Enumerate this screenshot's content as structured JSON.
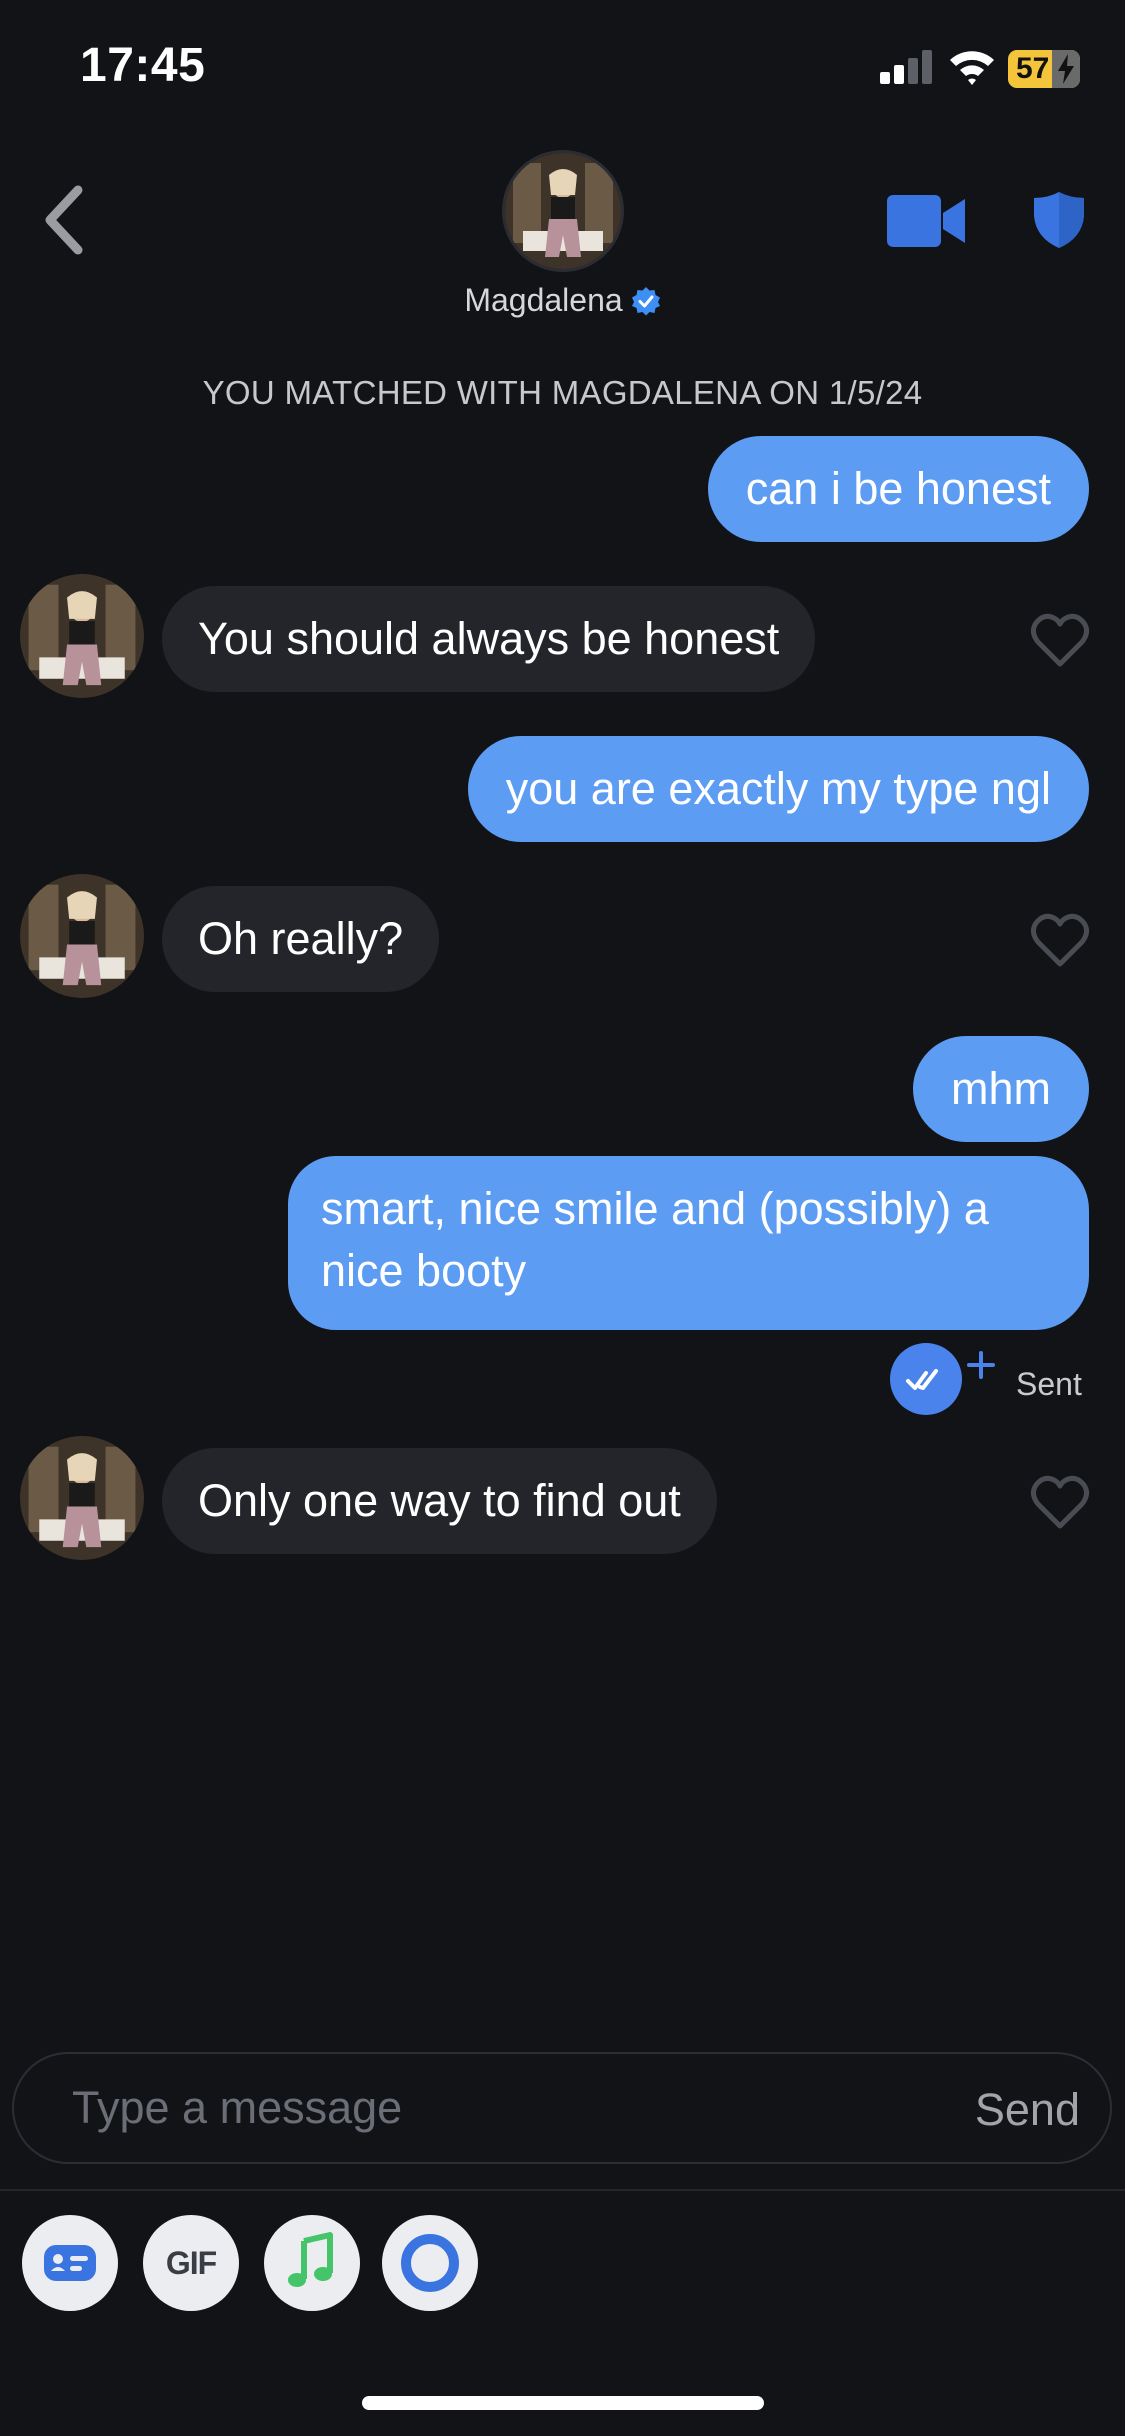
{
  "status_bar": {
    "time": "17:45",
    "battery_percent": "57",
    "icons": [
      "cellular-signal-icon",
      "wifi-icon",
      "battery-charging-icon"
    ]
  },
  "header": {
    "name": "Magdalena",
    "icons": [
      "back-chevron-icon",
      "verified-badge-icon",
      "video-call-icon",
      "safety-shield-icon"
    ]
  },
  "match_banner": "YOU MATCHED WITH MAGDALENA ON 1/5/24",
  "messages": [
    {
      "direction": "out",
      "text": "can i be honest"
    },
    {
      "direction": "in",
      "text": "You should always be honest"
    },
    {
      "direction": "out",
      "text": "you are exactly my type ngl"
    },
    {
      "direction": "in",
      "text": "Oh really?"
    },
    {
      "direction": "out",
      "text": "mhm"
    },
    {
      "direction": "out",
      "text": "smart, nice smile and (possibly) a nice booty",
      "lines": [
        "smart, nice smile and (possibly) a",
        "nice booty"
      ]
    },
    {
      "direction": "in",
      "text": "Only one way to find out"
    }
  ],
  "read_receipt": {
    "label": "Sent"
  },
  "composer": {
    "placeholder": "Type a message",
    "send_label": "Send"
  },
  "toolbar": {
    "gif_label": "GIF",
    "icons": [
      "prompt-card-icon",
      "gif-icon",
      "music-note-icon",
      "vibe-ring-icon"
    ]
  },
  "colors": {
    "background": "#111317",
    "outgoing_bubble": "#5c9cf3",
    "incoming_bubble": "#23252b",
    "accent_blue": "#3a74e0",
    "battery": "#f4c53b"
  }
}
